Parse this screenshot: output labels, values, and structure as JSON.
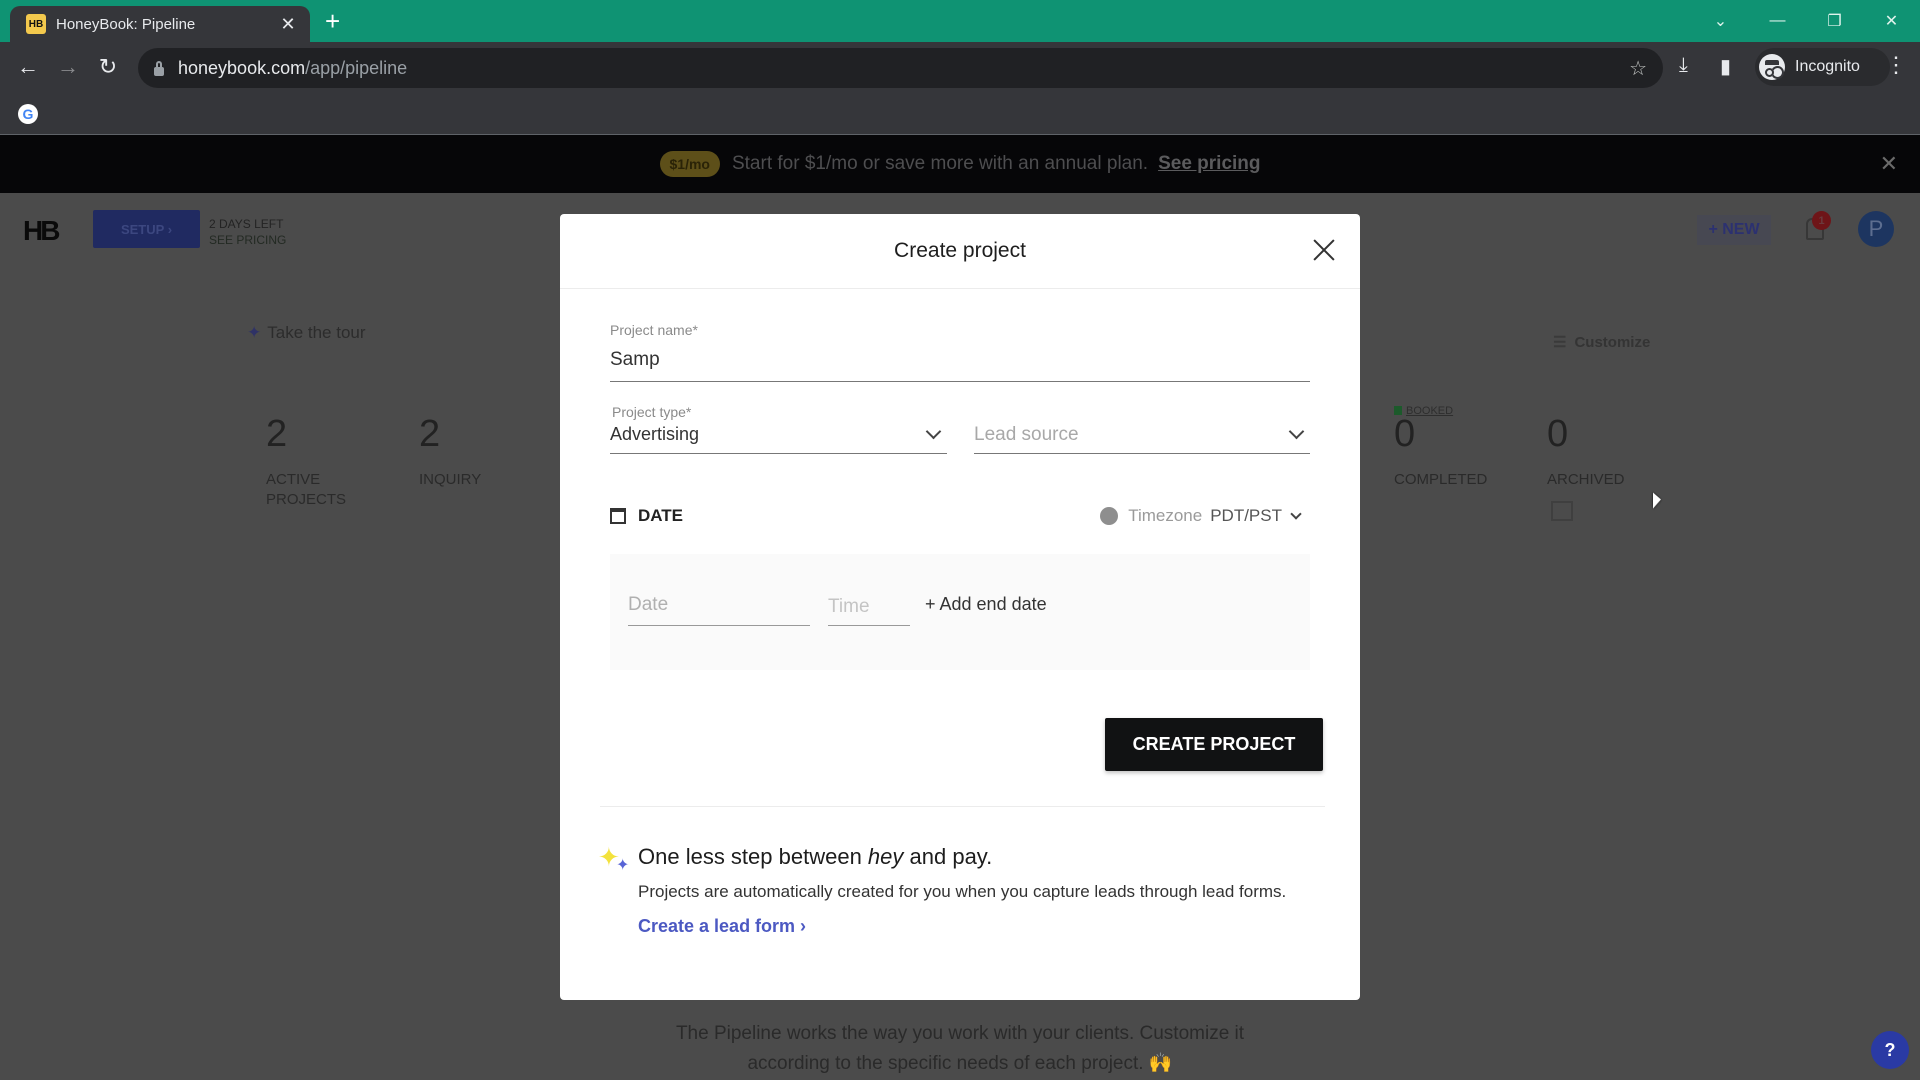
{
  "browser": {
    "tab": {
      "favicon_text": "HB",
      "title": "HoneyBook: Pipeline",
      "close": "✕"
    },
    "new_tab": "+",
    "window_controls": {
      "tab_search": "⌄",
      "minimize": "—",
      "restore": "❐",
      "close": "✕"
    },
    "nav": {
      "back": "←",
      "forward": "→",
      "reload": "↻"
    },
    "url": {
      "host": "honeybook.com",
      "path": "/app/pipeline"
    },
    "star": "☆",
    "download_icon": "⤓",
    "sidepanel_icon": "▮",
    "incognito_label": "Incognito",
    "menu": "⋮",
    "bookmark_google": "G"
  },
  "promo_banner": {
    "badge": "$1/mo",
    "text": "Start for $1/mo or save more with an annual plan.",
    "link": "See pricing",
    "close": "✕"
  },
  "app_header": {
    "logo": "HB",
    "setup_label": "SETUP  ›",
    "trial_days": "2 DAYS LEFT",
    "trial_link": "SEE PRICING",
    "new_label": "+ NEW",
    "notification_count": "1",
    "avatar_initial": "P"
  },
  "pipeline": {
    "tour_icon": "✦",
    "tour_label": "Take the tour",
    "customize_icon": "☰",
    "customize_label": "Customize",
    "metrics": [
      {
        "value": "2",
        "label": "ACTIVE PROJECTS"
      },
      {
        "value": "2",
        "label": "INQUIRY"
      },
      {
        "value": "0",
        "label": "COMPLETED"
      },
      {
        "value": "0",
        "label": "ARCHIVED"
      }
    ],
    "booked_label": "BOOKED",
    "note_line1": "The Pipeline works the way you work with your clients. Customize it",
    "note_line2": "according to the specific needs of each project. 🙌",
    "help": "?"
  },
  "modal": {
    "title": "Create project",
    "project_name": {
      "label": "Project name*",
      "value": "Samp"
    },
    "project_type": {
      "label": "Project type*",
      "value": "Advertising"
    },
    "lead_source": {
      "placeholder": "Lead source"
    },
    "date_section": {
      "heading": "DATE",
      "timezone_label": "Timezone",
      "timezone_value": "PDT/PST",
      "date_placeholder": "Date",
      "time_placeholder": "Time",
      "add_end_date": "+ Add end date"
    },
    "create_button": "CREATE PROJECT",
    "lead_promo": {
      "title_before": "One less step between ",
      "title_em": "hey",
      "title_after": " and pay.",
      "text": "Projects are automatically created for you when you capture leads through lead forms.",
      "link": "Create a lead form ›"
    }
  }
}
